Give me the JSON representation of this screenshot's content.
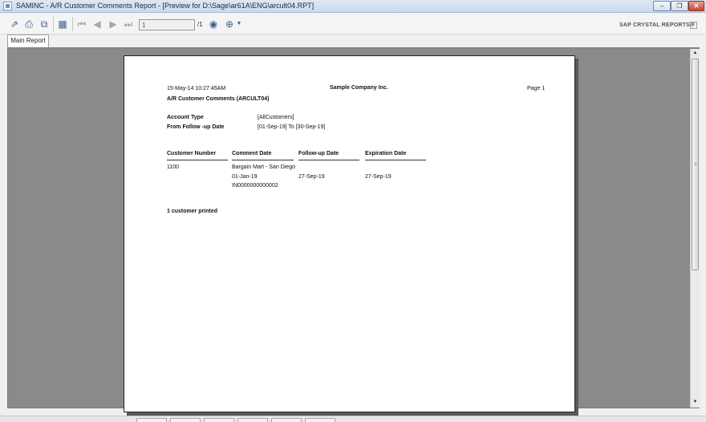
{
  "window": {
    "title": "SAMINC - A/R Customer Comments Report - [Preview for D:\\Sage\\ar61A\\ENG\\arcult04.RPT]"
  },
  "toolbar": {
    "page_input": "1",
    "page_total": "/1",
    "brand": "SAP CRYSTAL REPORTS®"
  },
  "tabs": [
    {
      "label": "Main Report"
    }
  ],
  "report": {
    "datetime": "15-May-14 10:27:45AM",
    "company": "Sample Company Inc.",
    "page": "Page 1",
    "title": "A/R Customer Comments (ARCULT04)",
    "params": [
      {
        "label": "Account Type",
        "value": "[AllCustomers]"
      },
      {
        "label": "From Follow -up Date",
        "value": "[01-Sep-19] To [30-Sep-19]"
      }
    ],
    "columns": [
      "Customer Number",
      "Comment Date",
      "Follow-up Date",
      "Expiration Date"
    ],
    "row": {
      "customer_number": "1100",
      "customer_name": "Bargain Mart - San Diego",
      "comment_date": "01-Jan-19",
      "followup_date": "27-Sep-19",
      "expiration_date": "27-Sep-19",
      "comment": "IN0000000000002"
    },
    "footer": "1 customer printed"
  }
}
